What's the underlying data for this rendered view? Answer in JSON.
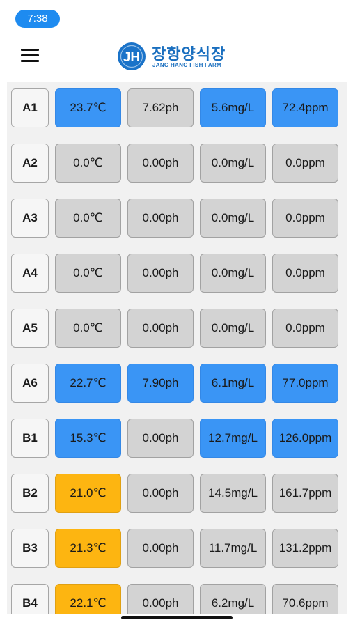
{
  "status_bar": {
    "time": "7:38"
  },
  "header": {
    "logo_initials": "JH",
    "logo_korean": "장항양식장",
    "logo_english": "JANG HANG FISH FARM"
  },
  "colors": {
    "normal": "#3a95f5",
    "warning": "#fdb511",
    "inactive": "#d3d3d3"
  },
  "rows": [
    {
      "tank": "A1",
      "temp": {
        "value": "23.7℃",
        "state": "blue"
      },
      "ph": {
        "value": "7.62ph",
        "state": "gray"
      },
      "do": {
        "value": "5.6mg/L",
        "state": "blue"
      },
      "ppm": {
        "value": "72.4ppm",
        "state": "blue"
      }
    },
    {
      "tank": "A2",
      "temp": {
        "value": "0.0℃",
        "state": "gray"
      },
      "ph": {
        "value": "0.00ph",
        "state": "gray"
      },
      "do": {
        "value": "0.0mg/L",
        "state": "gray"
      },
      "ppm": {
        "value": "0.0ppm",
        "state": "gray"
      }
    },
    {
      "tank": "A3",
      "temp": {
        "value": "0.0℃",
        "state": "gray"
      },
      "ph": {
        "value": "0.00ph",
        "state": "gray"
      },
      "do": {
        "value": "0.0mg/L",
        "state": "gray"
      },
      "ppm": {
        "value": "0.0ppm",
        "state": "gray"
      }
    },
    {
      "tank": "A4",
      "temp": {
        "value": "0.0℃",
        "state": "gray"
      },
      "ph": {
        "value": "0.00ph",
        "state": "gray"
      },
      "do": {
        "value": "0.0mg/L",
        "state": "gray"
      },
      "ppm": {
        "value": "0.0ppm",
        "state": "gray"
      }
    },
    {
      "tank": "A5",
      "temp": {
        "value": "0.0℃",
        "state": "gray"
      },
      "ph": {
        "value": "0.00ph",
        "state": "gray"
      },
      "do": {
        "value": "0.0mg/L",
        "state": "gray"
      },
      "ppm": {
        "value": "0.0ppm",
        "state": "gray"
      }
    },
    {
      "tank": "A6",
      "temp": {
        "value": "22.7℃",
        "state": "blue"
      },
      "ph": {
        "value": "7.90ph",
        "state": "blue"
      },
      "do": {
        "value": "6.1mg/L",
        "state": "blue"
      },
      "ppm": {
        "value": "77.0ppm",
        "state": "blue"
      }
    },
    {
      "tank": "B1",
      "temp": {
        "value": "15.3℃",
        "state": "blue"
      },
      "ph": {
        "value": "0.00ph",
        "state": "gray"
      },
      "do": {
        "value": "12.7mg/L",
        "state": "blue"
      },
      "ppm": {
        "value": "126.0ppm",
        "state": "blue"
      }
    },
    {
      "tank": "B2",
      "temp": {
        "value": "21.0℃",
        "state": "orange"
      },
      "ph": {
        "value": "0.00ph",
        "state": "gray"
      },
      "do": {
        "value": "14.5mg/L",
        "state": "gray"
      },
      "ppm": {
        "value": "161.7ppm",
        "state": "gray"
      }
    },
    {
      "tank": "B3",
      "temp": {
        "value": "21.3℃",
        "state": "orange"
      },
      "ph": {
        "value": "0.00ph",
        "state": "gray"
      },
      "do": {
        "value": "11.7mg/L",
        "state": "gray"
      },
      "ppm": {
        "value": "131.2ppm",
        "state": "gray"
      }
    },
    {
      "tank": "B4",
      "temp": {
        "value": "22.1℃",
        "state": "orange"
      },
      "ph": {
        "value": "0.00ph",
        "state": "gray"
      },
      "do": {
        "value": "6.2mg/L",
        "state": "gray"
      },
      "ppm": {
        "value": "70.6ppm",
        "state": "gray"
      }
    }
  ]
}
